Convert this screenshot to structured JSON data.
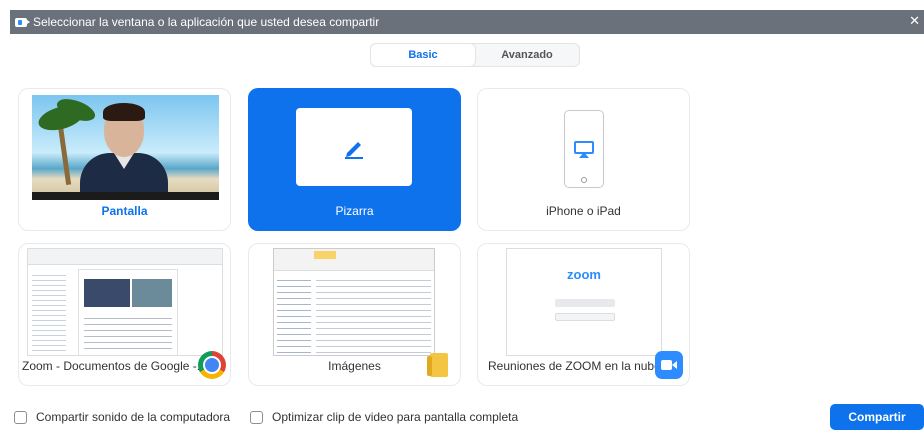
{
  "window": {
    "title": "Seleccionar la ventana o la aplicación que usted desea compartir"
  },
  "tabs": [
    {
      "label": "Basic",
      "active": true
    },
    {
      "label": "Avanzado",
      "active": false
    }
  ],
  "sources": [
    {
      "label": "Pantalla",
      "icon": "screen-thumbnail"
    },
    {
      "label": "Pizarra",
      "icon": "pen-icon",
      "selected": true
    },
    {
      "label": "iPhone o iPad",
      "icon": "airplay-icon"
    },
    {
      "label": "Zoom - Documentos de Google -...",
      "icon": "chrome-icon"
    },
    {
      "label": "Imágenes",
      "icon": "folder-icon"
    },
    {
      "label": "Reuniones de ZOOM en la nube",
      "icon": "zoom-app-icon"
    }
  ],
  "zoom_thumbnail": {
    "logo": "zoom"
  },
  "options": {
    "share_sound": "Compartir sonido de la computadora",
    "optimize_video": "Optimizar clip de video para pantalla completa"
  },
  "share_button": "Compartir",
  "colors": {
    "accent": "#0e72ed",
    "titlebar": "#6b717b"
  }
}
